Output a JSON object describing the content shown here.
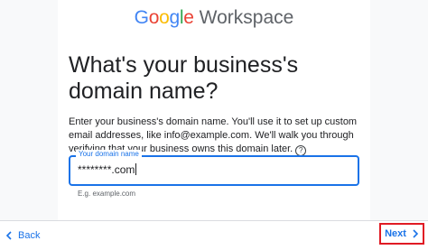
{
  "header": {
    "logo_text": "Google",
    "product_name": "Workspace"
  },
  "main": {
    "title": "What's your business's domain name?",
    "description": "Enter your business's domain name. You'll use it to set up custom email addresses, like info@example.com. We'll walk you through verifying that your business owns this domain later.",
    "help_icon_glyph": "?"
  },
  "domain_field": {
    "label": "Your domain name",
    "value": "********.com",
    "hint": "E.g. example.com"
  },
  "footer": {
    "back_label": "Back",
    "next_label": "Next"
  },
  "icons": {
    "back": "chevron-left-icon",
    "next": "chevron-right-icon",
    "help": "help-circle-icon"
  },
  "colors": {
    "accent": "#1a73e8",
    "highlight_box": "#e01b24",
    "google_blue": "#4285F4",
    "google_red": "#EA4335",
    "google_yellow": "#FBBC05",
    "google_green": "#34A853"
  }
}
